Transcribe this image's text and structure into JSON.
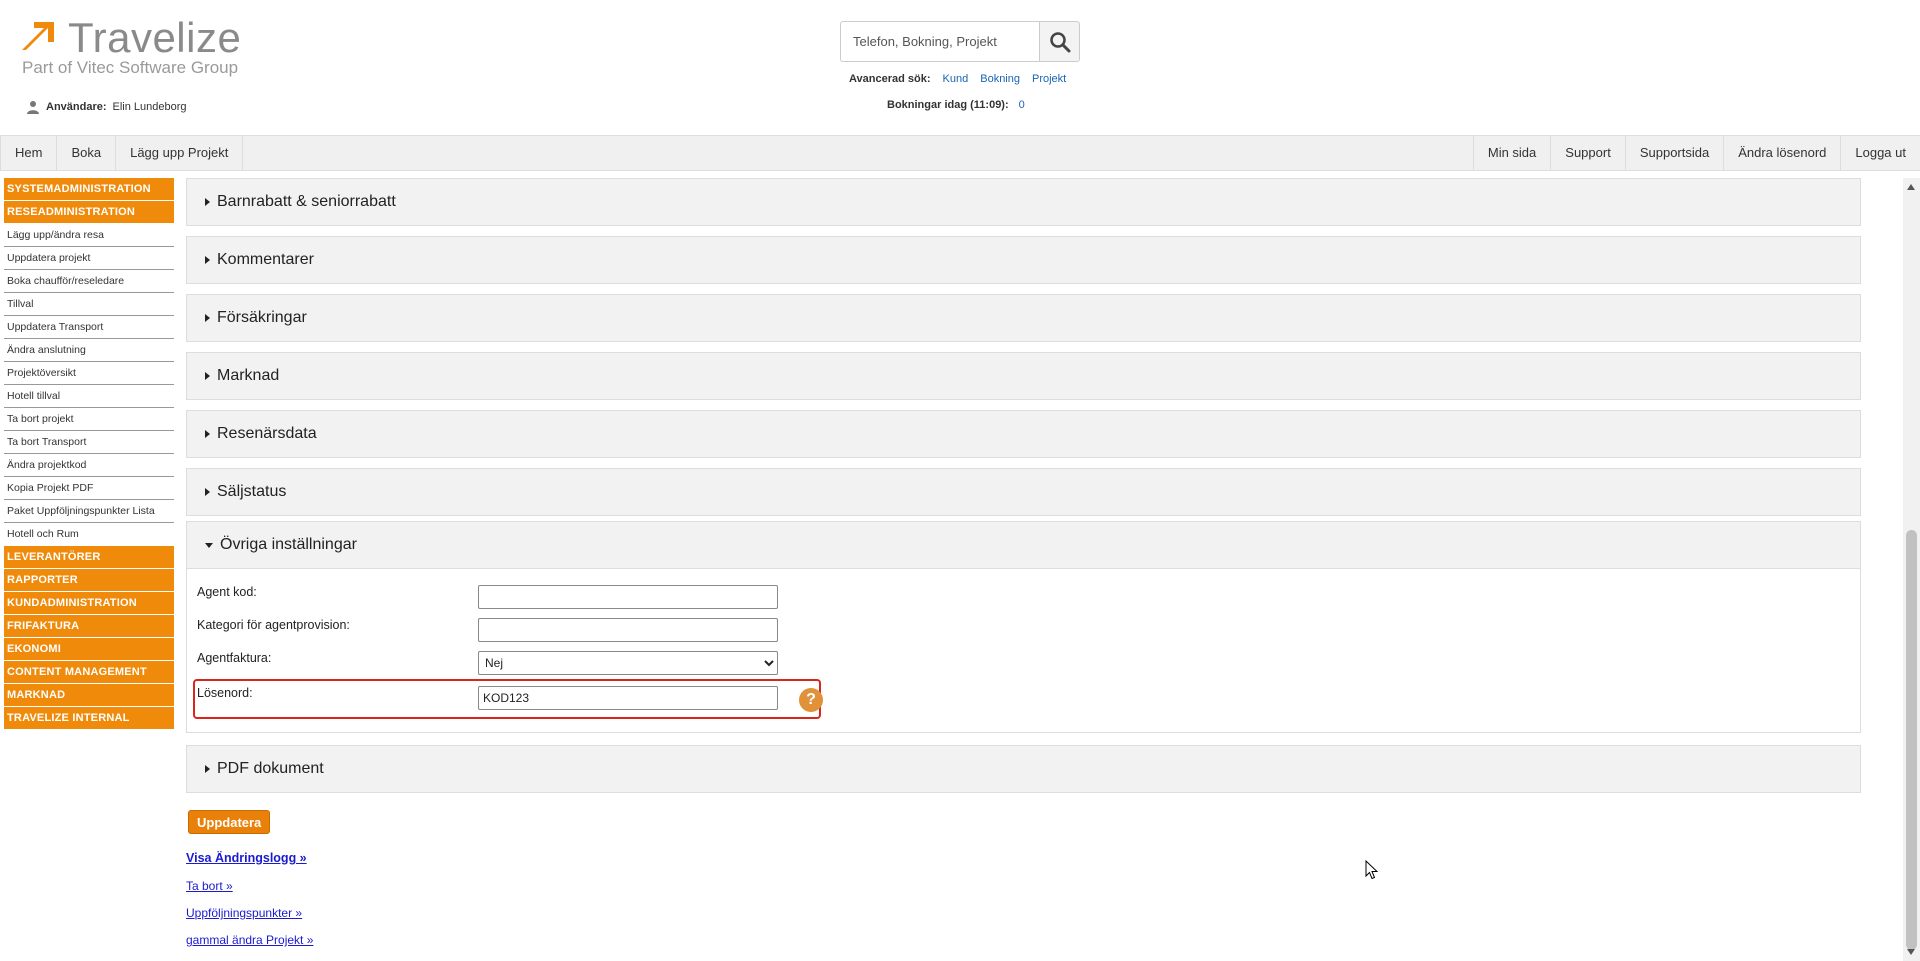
{
  "header": {
    "logo_text": "Travelize",
    "logo_sub": "Part of Vitec Software Group",
    "user_label": "Användare:",
    "user_name": "Elin Lundeborg",
    "search_placeholder": "Telefon, Bokning, Projekt",
    "advanced_label": "Avancerad sök:",
    "advanced_links": [
      "Kund",
      "Bokning",
      "Projekt"
    ],
    "today_label": "Bokningar idag (11:09):",
    "today_count": "0",
    "brand_color": "#f08a0a"
  },
  "nav": {
    "left": [
      "Hem",
      "Boka",
      "Lägg upp Projekt"
    ],
    "right": [
      "Min sida",
      "Support",
      "Supportsida",
      "Ändra lösenord",
      "Logga ut"
    ]
  },
  "sidebar": {
    "head_top": [
      "SYSTEMADMINISTRATION",
      "RESEADMINISTRATION"
    ],
    "items": [
      "Lägg upp/ändra resa",
      "Uppdatera projekt",
      "Boka chaufför/reseledare",
      "Tillval",
      "Uppdatera Transport",
      "Ändra anslutning",
      "Projektöversikt",
      "Hotell tillval",
      "Ta bort projekt",
      "Ta bort Transport",
      "Ändra projektkod",
      "Kopia Projekt PDF",
      "Paket Uppföljningspunkter Lista",
      "Hotell och Rum"
    ],
    "head_bottom": [
      "LEVERANTÖRER",
      "RAPPORTER",
      "KUNDADMINISTRATION",
      "FRIFAKTURA",
      "EKONOMI",
      "CONTENT MANAGEMENT",
      "MARKNAD",
      "TRAVELIZE INTERNAL"
    ]
  },
  "panels": {
    "collapsed_top": [
      "Barnrabatt & seniorrabatt",
      "Kommentarer",
      "Försäkringar",
      "Marknad",
      "Resenärsdata",
      "Säljstatus"
    ],
    "expanded": "Övriga inställningar",
    "collapsed_bottom": [
      "PDF dokument"
    ]
  },
  "form": {
    "agent_code_label": "Agent kod:",
    "agent_code_value": "",
    "agent_category_label": "Kategori för agentprovision:",
    "agent_category_value": "",
    "agent_invoice_label": "Agentfaktura:",
    "agent_invoice_value": "Nej",
    "password_label": "Lösenord:",
    "password_value": "KOD123",
    "help_symbol": "?"
  },
  "actions": {
    "update_label": "Uppdatera",
    "links": [
      "Visa Ändringslogg »",
      "Ta bort »",
      "Uppföljningspunkter »",
      "gammal ändra Projekt »"
    ]
  }
}
